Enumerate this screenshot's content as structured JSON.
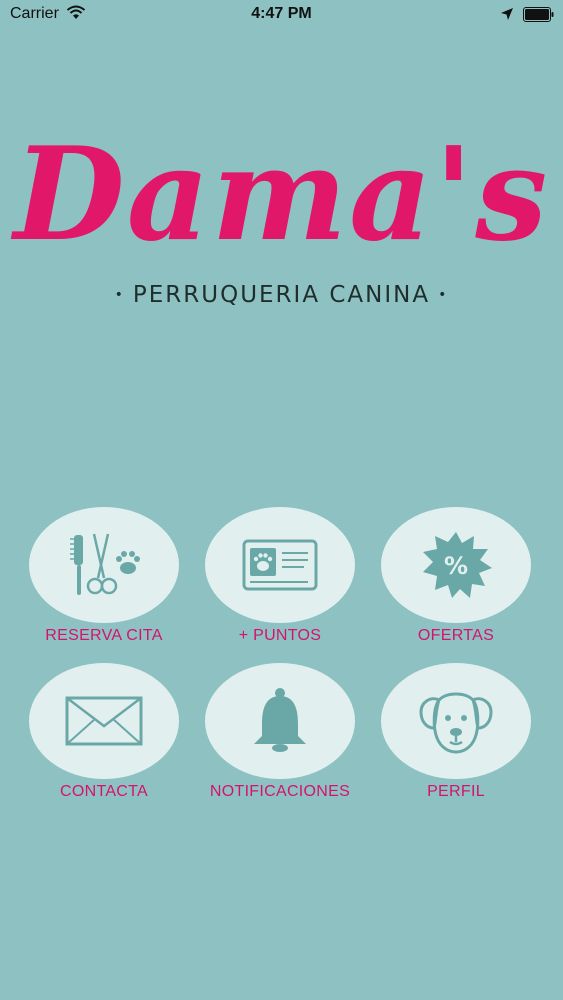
{
  "status_bar": {
    "carrier": "Carrier",
    "time": "4:47 PM"
  },
  "logo": {
    "script_text": "Dama's",
    "subtitle": "PERRUQUERIA CANINA",
    "bullet": "•"
  },
  "colors": {
    "background": "#8ec2c2",
    "accent": "#e1186a",
    "circle": "#e2efef",
    "icon": "#6aa8a8"
  },
  "menu": {
    "items": [
      {
        "label": "RESERVA CITA",
        "icon": "grooming-tools-icon"
      },
      {
        "label": "+ PUNTOS",
        "icon": "loyalty-card-icon"
      },
      {
        "label": "OFERTAS",
        "icon": "discount-badge-icon"
      },
      {
        "label": "CONTACTA",
        "icon": "envelope-icon"
      },
      {
        "label": "NOTIFICACIONES",
        "icon": "bell-icon"
      },
      {
        "label": "PERFIL",
        "icon": "dog-face-icon"
      }
    ]
  }
}
